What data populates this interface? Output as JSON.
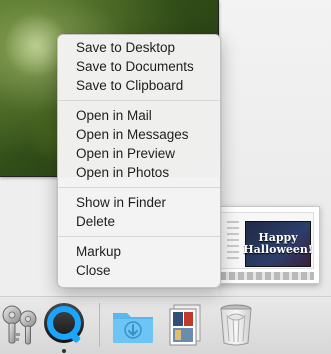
{
  "context_menu": {
    "groups": [
      [
        "Save to Desktop",
        "Save to Documents",
        "Save to Clipboard"
      ],
      [
        "Open in Mail",
        "Open in Messages",
        "Open in Preview",
        "Open in Photos"
      ],
      [
        "Show in Finder",
        "Delete"
      ],
      [
        "Markup",
        "Close"
      ]
    ]
  },
  "thumbnail": {
    "line1": "Happy",
    "line2": "Halloween!"
  },
  "dock": {
    "items": [
      "keychain-access-icon",
      "quicktime-player-icon",
      "downloads-folder-icon",
      "documents-stack-icon",
      "trash-icon"
    ]
  },
  "colors": {
    "menu_bg": "#f3f3f3",
    "menu_text": "#1e1e1e",
    "separator": "#d6d6d6",
    "quicktime_blue": "#1aa6ff",
    "downloads_blue": "#57b8ee"
  }
}
